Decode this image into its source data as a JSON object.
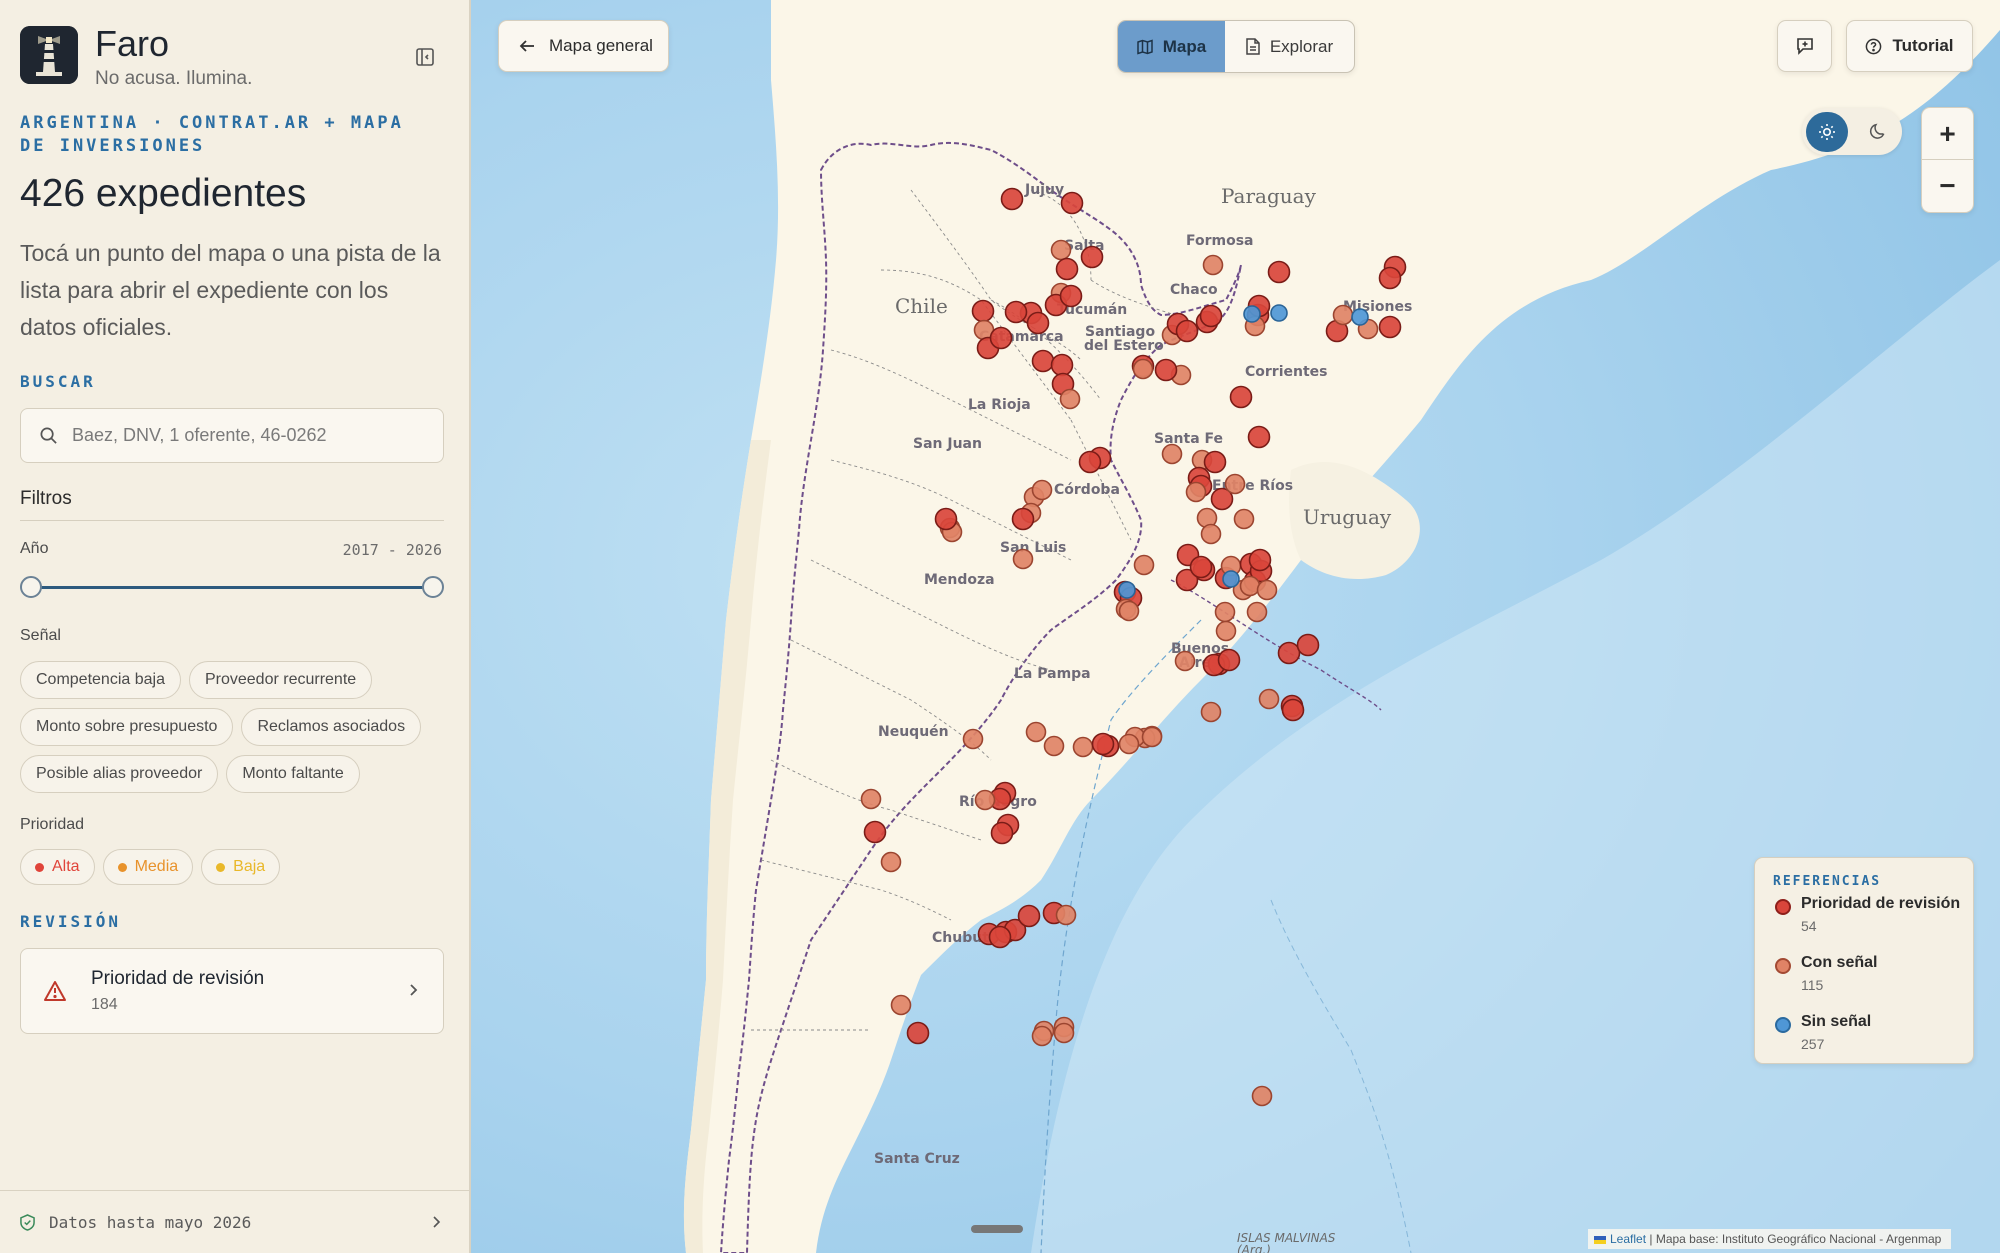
{
  "app": {
    "name": "Faro",
    "tagline": "No acusa. Ilumina."
  },
  "sidebar": {
    "context": "ARGENTINA · CONTRAT.AR + MAPA DE INVERSIONES",
    "count_title": "426 expedientes",
    "description": "Tocá un punto del mapa o una pista de la lista para abrir el expediente con los datos oficiales.",
    "search_label": "BUSCAR",
    "search_placeholder": "Baez, DNV, 1 oferente, 46-0262",
    "filters_title": "Filtros",
    "year": {
      "label": "Año",
      "range": "2017 - 2026",
      "min": 2017,
      "max": 2026,
      "from": 2017,
      "to": 2026
    },
    "signal_label": "Señal",
    "signals": [
      "Competencia baja",
      "Proveedor recurrente",
      "Monto sobre presupuesto",
      "Reclamos asociados",
      "Posible alias proveedor",
      "Monto faltante"
    ],
    "priority_label": "Prioridad",
    "priorities": [
      {
        "label": "Alta",
        "color": "#e0443a"
      },
      {
        "label": "Media",
        "color": "#e8922b"
      },
      {
        "label": "Baja",
        "color": "#e9b82a"
      }
    ],
    "review_label": "REVISIÓN",
    "review_card": {
      "title": "Prioridad de revisión",
      "count": "184",
      "icon": "warning-triangle-icon"
    },
    "footer": "Datos hasta mayo 2026"
  },
  "toolbar": {
    "back_label": "Mapa general",
    "map_tab": "Mapa",
    "explore_tab": "Explorar",
    "tutorial_label": "Tutorial"
  },
  "zoom": {
    "in": "+",
    "out": "−"
  },
  "legend": {
    "title": "REFERENCIAS",
    "items": [
      {
        "label": "Prioridad de revisión",
        "count": "54",
        "color": "#d9453b"
      },
      {
        "label": "Con señal",
        "count": "115",
        "color": "#e08366"
      },
      {
        "label": "Sin señal",
        "count": "257",
        "color": "#4f97d6"
      }
    ]
  },
  "attribution": {
    "leaflet": "Leaflet",
    "text": "| Mapa base: Instituto Geográfico Nacional - Argenmap"
  },
  "map_labels": {
    "countries": [
      "Paraguay",
      "Chile",
      "Uruguay"
    ],
    "provinces": [
      "Jujuy",
      "Salta",
      "Formosa",
      "Chaco",
      "Misiones",
      "Tucumán",
      "Catamarca",
      "Santiago",
      "del Estero",
      "Corrientes",
      "La Rioja",
      "San Juan",
      "Santa Fe",
      "Córdoba",
      "Entre Ríos",
      "San Luis",
      "Mendoza",
      "Buenos",
      "Aires",
      "La Pampa",
      "Neuquén",
      "Río Negro",
      "Chubut",
      "Santa Cruz"
    ],
    "sea": [
      "ISLAS MALVINAS",
      "(Arg.)"
    ]
  },
  "colors": {
    "accent": "#2b6ea3",
    "priority": "#d9453b",
    "signal": "#e08366",
    "nosignal": "#4f97d6"
  }
}
